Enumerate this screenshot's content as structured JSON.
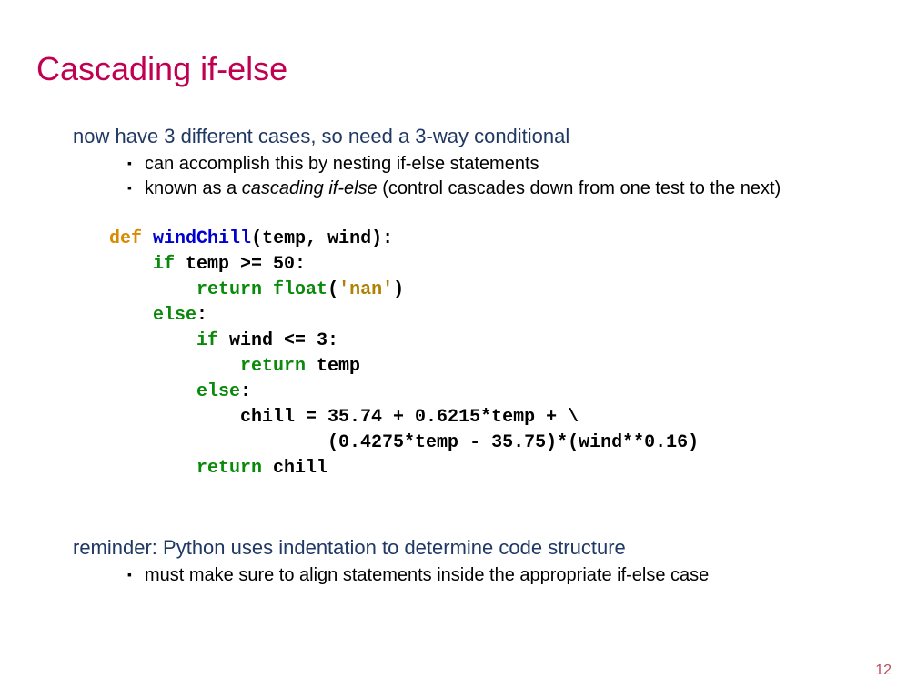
{
  "title": "Cascading if-else",
  "section1": {
    "heading": "now have 3 different cases, so need a 3-way conditional",
    "bullets": [
      {
        "pre": "can accomplish this by nesting if-else statements",
        "ital": "",
        "post": ""
      },
      {
        "pre": "known as a ",
        "ital": "cascading if-else",
        "post": " (control cascades down from one test to the next)"
      }
    ]
  },
  "code": {
    "kw_def": "def",
    "fn": "windChill",
    "sig_tail": "(temp, wind):",
    "l2a": "    ",
    "l2_if": "if",
    "l2b": " temp >= 50:",
    "l3a": "        ",
    "l3_ret": "return",
    "l3sp": " ",
    "l3_float": "float",
    "l3_par": "(",
    "l3_str": "'nan'",
    "l3_close": ")",
    "l4a": "    ",
    "l4_else": "else",
    "l4b": ":",
    "l5a": "        ",
    "l5_if": "if",
    "l5b": " wind <= 3:",
    "l6a": "            ",
    "l6_ret": "return",
    "l6b": " temp",
    "l7a": "        ",
    "l7_else": "else",
    "l7b": ":",
    "l8": "            chill = 35.74 + 0.6215*temp + \\",
    "l9": "                    (0.4275*temp - 35.75)*(wind**0.16)",
    "l10a": "        ",
    "l10_ret": "return",
    "l10b": " chill"
  },
  "section2": {
    "heading": "reminder: Python uses indentation to determine code structure",
    "bullets": [
      {
        "pre": "must make sure to align statements inside the appropriate if-else case",
        "ital": "",
        "post": ""
      }
    ]
  },
  "page_number": "12"
}
